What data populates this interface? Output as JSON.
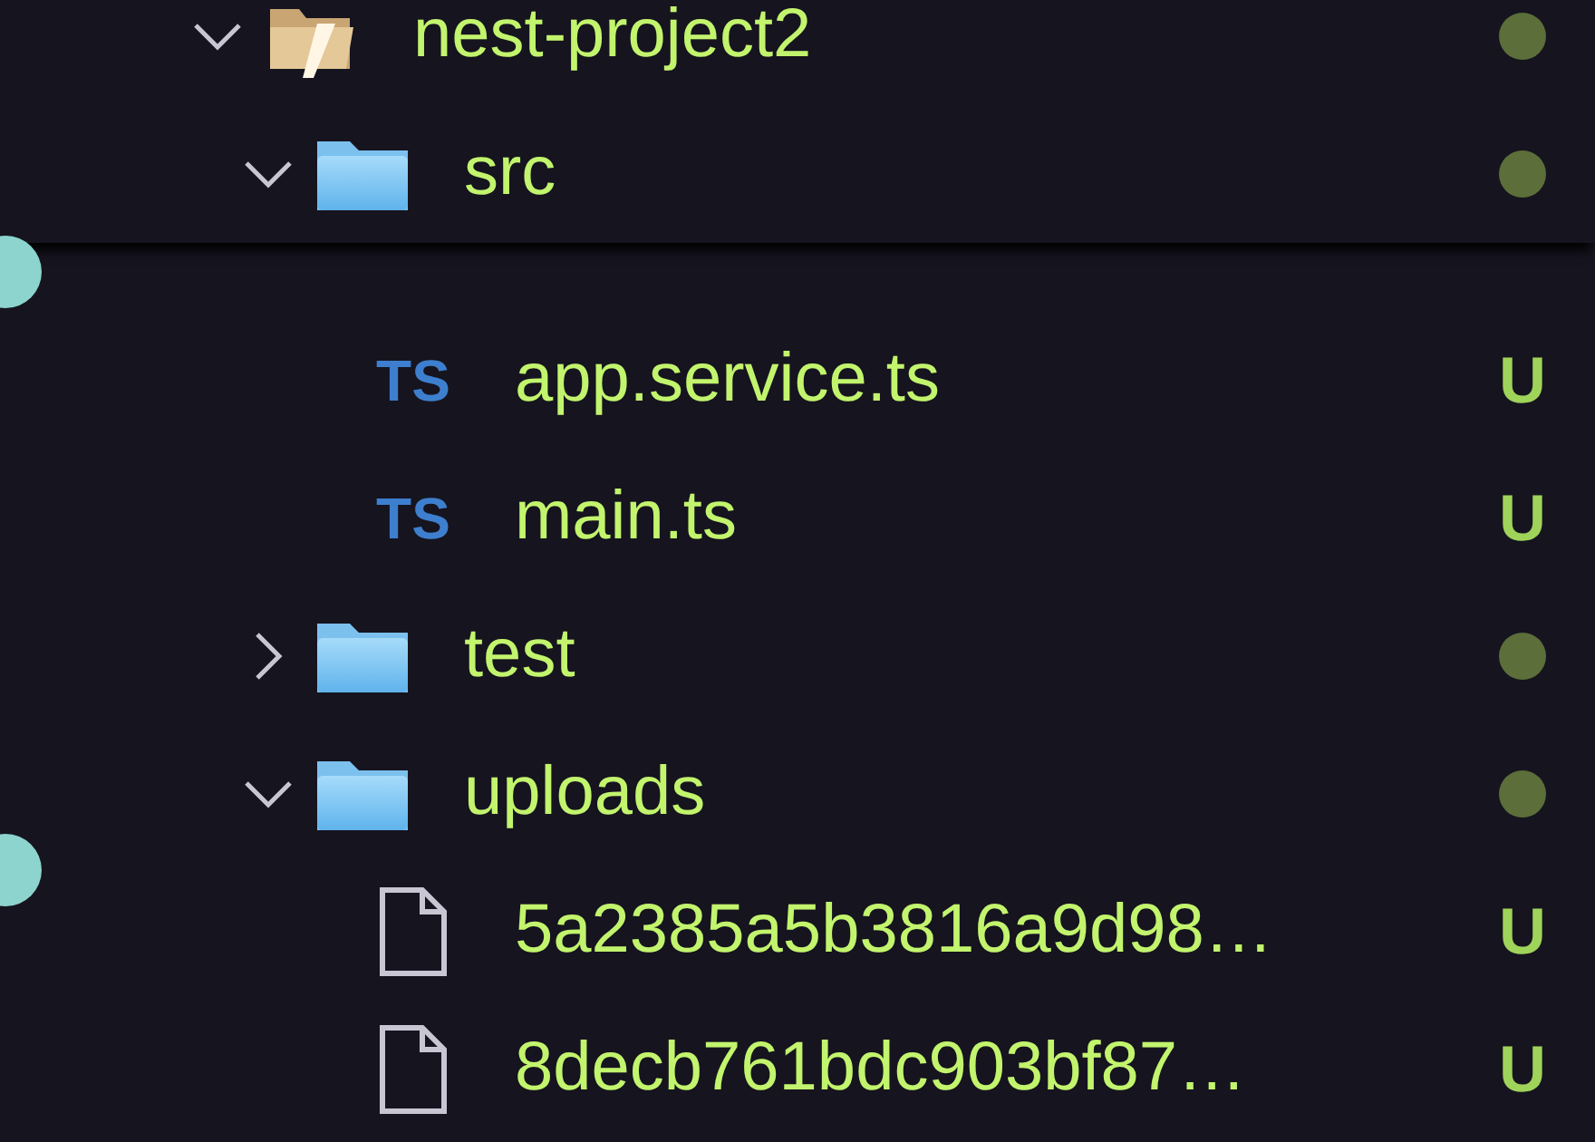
{
  "tree": [
    {
      "name": "nest-project2",
      "kind": "root",
      "expanded": true,
      "has_changes": true,
      "children": [
        {
          "name": "src",
          "kind": "folder",
          "expanded": true,
          "has_changes": true,
          "children": [
            {
              "name": "app.service.ts",
              "kind": "ts",
              "icon_text": "TS",
              "git_status": "U"
            },
            {
              "name": "main.ts",
              "kind": "ts",
              "icon_text": "TS",
              "git_status": "U"
            }
          ]
        },
        {
          "name": "test",
          "kind": "folder",
          "expanded": false,
          "has_changes": true
        },
        {
          "name": "uploads",
          "kind": "folder",
          "expanded": true,
          "has_changes": true,
          "children": [
            {
              "name": "5a2385a5b3816a9d98…",
              "kind": "file",
              "git_status": "U"
            },
            {
              "name": "8decb761bdc903bf87…",
              "kind": "file",
              "git_status": "U"
            }
          ]
        }
      ]
    }
  ]
}
